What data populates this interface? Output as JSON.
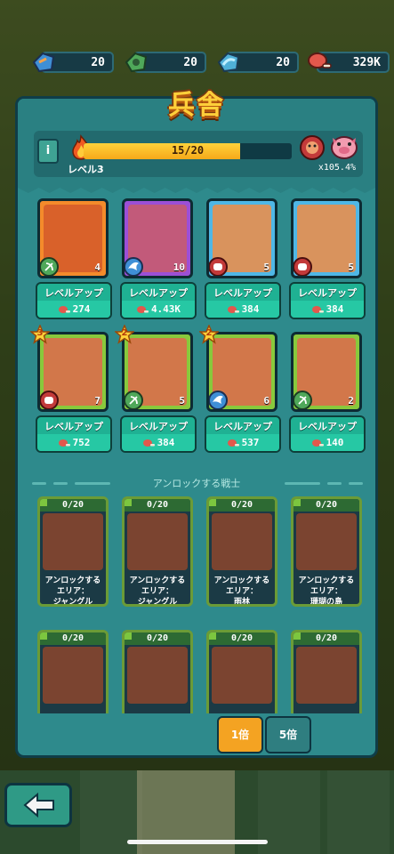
{
  "resources": [
    {
      "icon": "blue-gem-icon",
      "value": "20"
    },
    {
      "icon": "green-gem-icon",
      "value": "20"
    },
    {
      "icon": "cyan-gem-icon",
      "value": "20"
    },
    {
      "icon": "meat-icon",
      "value": "329K"
    }
  ],
  "barracks": {
    "title": "兵舎",
    "info_label": "i",
    "level_label": "レベル3",
    "progress_text": "15/20",
    "progress": 0.75,
    "multiplier": "x105.4%"
  },
  "owned_heroes": [
    {
      "level": "4",
      "frame": "orange",
      "class": "bow",
      "stars": "",
      "upgrade_label": "レベルアップ",
      "cost": "274"
    },
    {
      "level": "10",
      "frame": "purple",
      "class": "wing",
      "stars": "",
      "upgrade_label": "レベルアップ",
      "cost": "4.43K"
    },
    {
      "level": "5",
      "frame": "blue",
      "class": "fist",
      "stars": "",
      "upgrade_label": "レベルアップ",
      "cost": "384"
    },
    {
      "level": "5",
      "frame": "blue",
      "class": "fist",
      "stars": "",
      "upgrade_label": "レベルアップ",
      "cost": "384"
    },
    {
      "level": "7",
      "frame": "green",
      "class": "fist",
      "stars": "3",
      "upgrade_label": "レベルアップ",
      "cost": "752"
    },
    {
      "level": "5",
      "frame": "green",
      "class": "bow",
      "stars": "2",
      "upgrade_label": "レベルアップ",
      "cost": "384"
    },
    {
      "level": "6",
      "frame": "green",
      "class": "wing",
      "stars": "2",
      "upgrade_label": "レベルアップ",
      "cost": "537"
    },
    {
      "level": "2",
      "frame": "green",
      "class": "bow",
      "stars": "",
      "upgrade_label": "レベルアップ",
      "cost": "140"
    }
  ],
  "locked_section_title": "アンロックする戦士",
  "locked_heroes": [
    {
      "count": "0/20",
      "unlock_line1": "アンロックする",
      "unlock_line2": "エリア：",
      "area": "ジャングル"
    },
    {
      "count": "0/20",
      "unlock_line1": "アンロックする",
      "unlock_line2": "エリア：",
      "area": "ジャングル"
    },
    {
      "count": "0/20",
      "unlock_line1": "アンロックする",
      "unlock_line2": "エリア：",
      "area": "雨林"
    },
    {
      "count": "0/20",
      "unlock_line1": "アンロックする",
      "unlock_line2": "エリア：",
      "area": "珊瑚の島"
    },
    {
      "count": "0/20",
      "unlock_line1": "",
      "unlock_line2": "",
      "area": ""
    },
    {
      "count": "0/20",
      "unlock_line1": "",
      "unlock_line2": "",
      "area": ""
    },
    {
      "count": "0/20",
      "unlock_line1": "",
      "unlock_line2": "",
      "area": ""
    },
    {
      "count": "0/20",
      "unlock_line1": "",
      "unlock_line2": "",
      "area": ""
    }
  ],
  "multiplier_buttons": [
    "1倍",
    "5倍"
  ],
  "colors": {
    "accent": "#f4a322",
    "panel": "#2e8a8c",
    "upgrade": "#1fb193"
  }
}
